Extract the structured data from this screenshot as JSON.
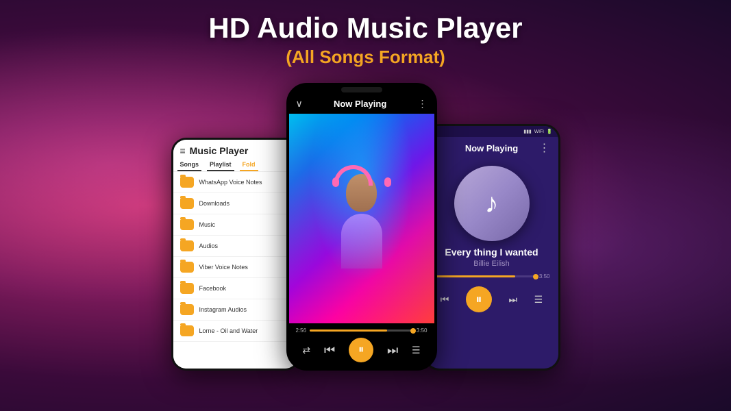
{
  "header": {
    "main_title": "HD Audio Music Player",
    "subtitle": "(All Songs Format)"
  },
  "phones": {
    "left": {
      "title": "Music Player",
      "tabs": [
        {
          "label": "Songs",
          "state": "selected"
        },
        {
          "label": "Playlist",
          "state": "selected"
        },
        {
          "label": "Fold",
          "state": "active"
        }
      ],
      "file_items": [
        {
          "name": "WhatsApp Voice Notes"
        },
        {
          "name": "Downloads"
        },
        {
          "name": "Music"
        },
        {
          "name": "Audios"
        },
        {
          "name": "Viber Voice Notes"
        },
        {
          "name": "Facebook"
        },
        {
          "name": "Instagram Audios"
        },
        {
          "name": "Lorne - Oil and Water"
        }
      ]
    },
    "center": {
      "header_title": "Now Playing",
      "time_current": "2:56",
      "time_total": "3:50",
      "progress_percent": 75
    },
    "right": {
      "header_title": "Now Playing",
      "song_title": "Every thing I wanted",
      "song_artist": "Billie Eilish",
      "time_total": "3:50",
      "progress_percent": 80
    }
  },
  "icons": {
    "hamburger": "≡",
    "chevron_down": "∨",
    "dots": "⋮",
    "prev": "⏮",
    "play": "▶",
    "pause": "⏸",
    "next": "⏭",
    "shuffle": "⇄",
    "repeat": "↺",
    "queue": "☰",
    "music_note": "♪"
  }
}
